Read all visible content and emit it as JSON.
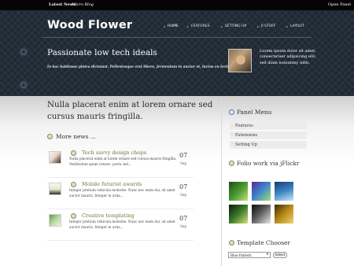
{
  "topbar": {
    "latest_label": "Latest News:",
    "latest_value": "Micro Blog",
    "open_panel": "Open Panel"
  },
  "header": {
    "logo": "Wood Flower",
    "nav": [
      {
        "label": "HOME",
        "active": true
      },
      {
        "label": "FEATURES"
      },
      {
        "label": "SETTING UP"
      },
      {
        "label": "JI STUFF"
      },
      {
        "label": "LAYOUT"
      }
    ],
    "tagline": "Passionate low tech ideals",
    "subtagline": "In hac habitasse platea dictumst. Pellentesque erat libero, fermentum in auctor et, luctus eu lectus.",
    "intro_text": "Lorem ipsum dolor sit amet, consectetuer adipiscing elit, sed diam nonummy nibh."
  },
  "main": {
    "heading": "Nulla placerat enim at lorem ornare sed cursus mauris fringilla.",
    "more_news_title": "More news ...",
    "news": [
      {
        "title": "Tech savvy design chops",
        "text": "Nulla placerat enim at lorem ornare sed cursus mauris fringilla. Vestibulum quam ornare, porta sed...",
        "day": "07",
        "month": "Sep"
      },
      {
        "title": "Mobile futurist awards",
        "text": "Integer pretium vehicula molestie. Nunc nec enim dui, sit amet auctor mauris. Integer in urna...",
        "day": "07",
        "month": "Sep"
      },
      {
        "title": "Creative templating",
        "text": "Integer pretium vehicula molestie. Nunc nec enim dui, sit amet auctor mauris. Integer in urna...",
        "day": "07",
        "month": "Sep"
      }
    ]
  },
  "sidebar": {
    "panel_menu_title": "Panel Menu",
    "panel_items": [
      "Features",
      "Extensions",
      "Setting Up"
    ],
    "flickr_title": "Folio work via jFlickr",
    "template_title": "Template Chooser",
    "template_value": "Blue Pattern",
    "select_button": "Select"
  }
}
